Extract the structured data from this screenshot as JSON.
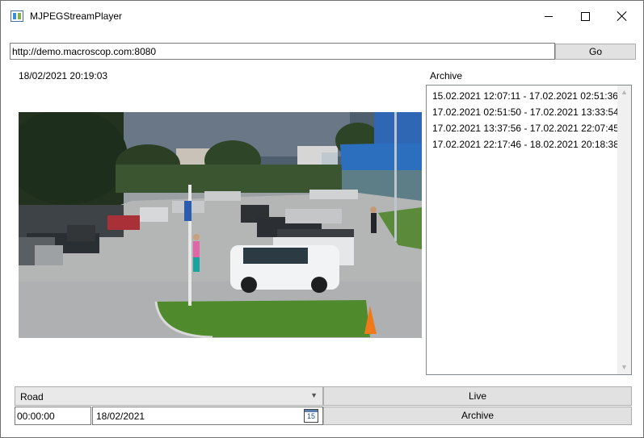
{
  "window": {
    "title": "MJPEGStreamPlayer",
    "icons": {
      "app": "app-window-icon",
      "minimize": "minimize-icon",
      "maximize": "maximize-icon",
      "close": "close-icon"
    }
  },
  "toolbar": {
    "url_value": "http://demo.macroscop.com:8080",
    "go_label": "Go"
  },
  "video": {
    "timestamp": "18/02/2021 20:19:03",
    "content": "parking-lot-camera-feed"
  },
  "archive": {
    "label": "Archive",
    "items": [
      "15.02.2021 12:07:11 - 17.02.2021 02:51:36",
      "17.02.2021 02:51:50 - 17.02.2021 13:33:54",
      "17.02.2021 13:37:56 - 17.02.2021 22:07:45",
      "17.02.2021 22:17:46 - 18.02.2021 20:18:38"
    ]
  },
  "controls": {
    "camera_selected": "Road",
    "time_value": "00:00:00",
    "date_value": "18/02/2021",
    "calendar_icon_text": "15",
    "live_label": "Live",
    "archive_label": "Archive"
  }
}
